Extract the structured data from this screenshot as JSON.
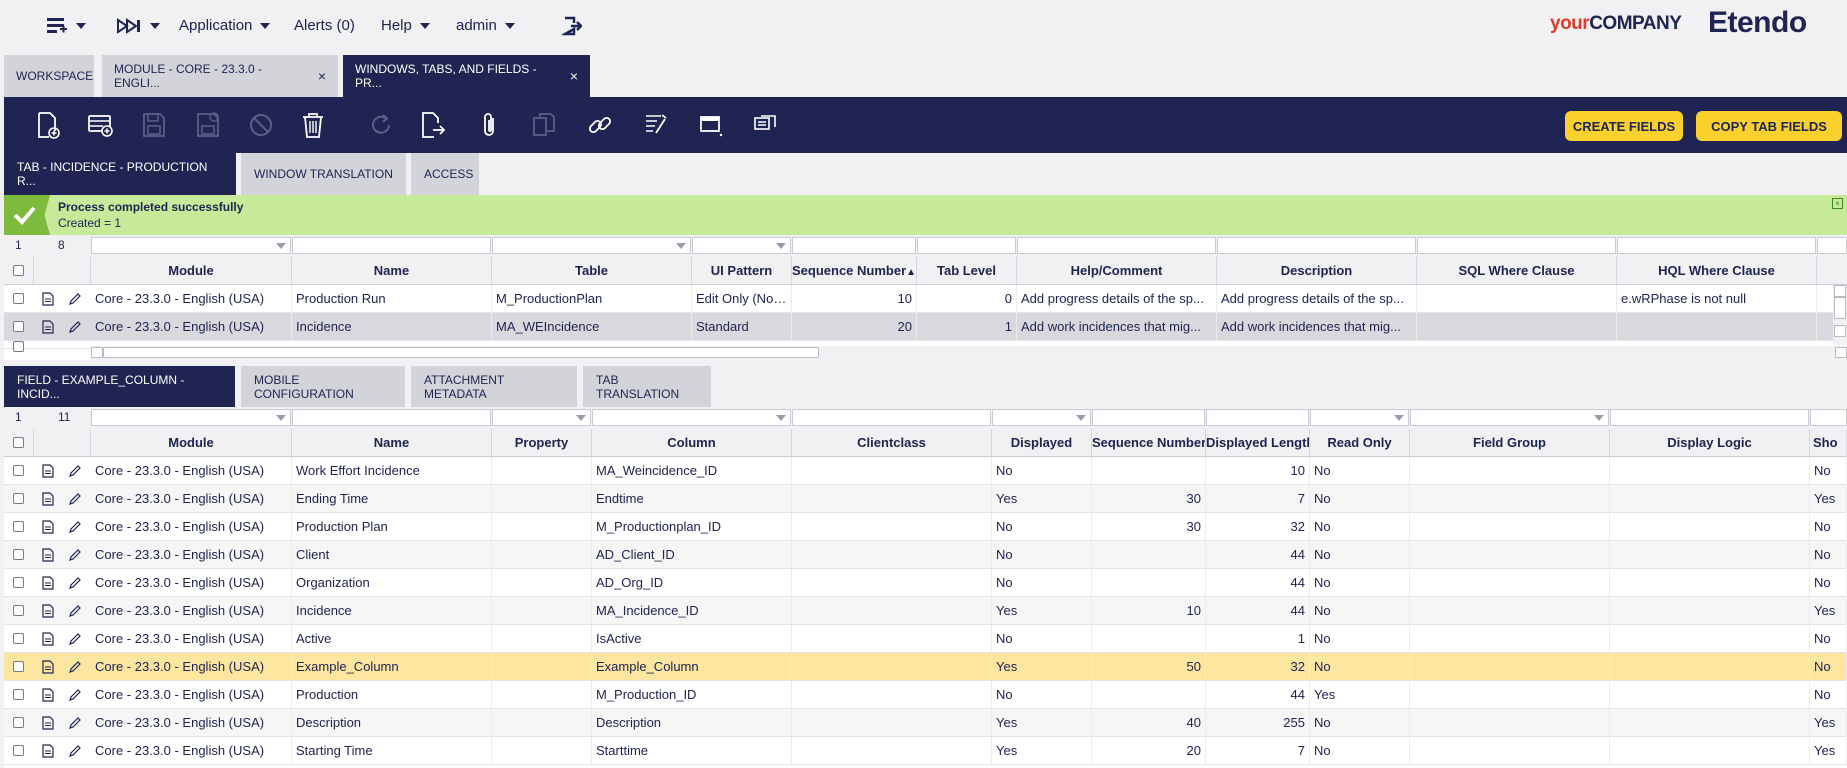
{
  "topbar": {
    "application": "Application",
    "alerts": "Alerts (0)",
    "help": "Help",
    "user": "admin",
    "logo_your": "your",
    "logo_company": "COMPANY",
    "logo_etendo": "Etendo"
  },
  "main_tabs": [
    {
      "label": "WORKSPACE",
      "closable": false
    },
    {
      "label": "MODULE - CORE - 23.3.0 - ENGLI...",
      "closable": true
    },
    {
      "label": "WINDOWS, TABS, AND FIELDS - PR...",
      "closable": true,
      "active": true
    }
  ],
  "toolbar": {
    "icons": [
      "new-document-icon",
      "new-row-icon",
      "save-icon",
      "save-close-icon",
      "undo-icon",
      "delete-icon",
      "refresh-icon",
      "export-icon",
      "attachment-icon",
      "clone-icon",
      "link-icon",
      "audit-trail-icon",
      "form-grid-toggle-icon",
      "notes-icon"
    ],
    "create_fields": "CREATE FIELDS",
    "copy_tab_fields": "COPY TAB FIELDS"
  },
  "tab_level": {
    "tabs": [
      {
        "label": "TAB - INCIDENCE - PRODUCTION R...",
        "active": true
      },
      {
        "label": "WINDOW TRANSLATION"
      },
      {
        "label": "ACCESS"
      }
    ]
  },
  "message": {
    "title": "Process completed successfully",
    "detail": "Created = 1"
  },
  "upper_grid": {
    "selected_count": "1",
    "total_count": "8",
    "columns": [
      "Module",
      "Name",
      "Table",
      "UI Pattern",
      "Sequence Number",
      "Tab Level",
      "Help/Comment",
      "Description",
      "SQL Where Clause",
      "HQL Where Clause"
    ],
    "sort_indicator": "▲",
    "rows": [
      [
        "Core - 23.3.0 - English (USA)",
        "Production Run",
        "M_ProductionPlan",
        "Edit Only (No I...",
        "10",
        "0",
        "Add progress details of the sp...",
        "Add progress details of the sp...",
        "",
        "e.wRPhase is not null"
      ],
      [
        "Core - 23.3.0 - English (USA)",
        "Incidence",
        "MA_WEIncidence",
        "Standard",
        "20",
        "1",
        "Add work incidences that mig...",
        "Add work incidences that mig...",
        "",
        ""
      ]
    ]
  },
  "field_level": {
    "tabs": [
      {
        "label": "FIELD - EXAMPLE_COLUMN - INCID...",
        "active": true
      },
      {
        "label": "MOBILE CONFIGURATION"
      },
      {
        "label": "ATTACHMENT METADATA"
      },
      {
        "label": "TAB TRANSLATION"
      }
    ]
  },
  "lower_grid": {
    "selected_count": "1",
    "total_count": "11",
    "columns": [
      "Module",
      "Name",
      "Property",
      "Column",
      "Clientclass",
      "Displayed",
      "Sequence Number",
      "Displayed Length",
      "Read Only",
      "Field Group",
      "Display Logic",
      "Sho"
    ],
    "rows": [
      [
        "Core - 23.3.0 - English (USA)",
        "Work Effort Incidence",
        "",
        "MA_Weincidence_ID",
        "",
        "No",
        "",
        "10",
        "No",
        "",
        "",
        "No"
      ],
      [
        "Core - 23.3.0 - English (USA)",
        "Ending Time",
        "",
        "Endtime",
        "",
        "Yes",
        "30",
        "7",
        "No",
        "",
        "",
        "Yes"
      ],
      [
        "Core - 23.3.0 - English (USA)",
        "Production Plan",
        "",
        "M_Productionplan_ID",
        "",
        "No",
        "30",
        "32",
        "No",
        "",
        "",
        "No"
      ],
      [
        "Core - 23.3.0 - English (USA)",
        "Client",
        "",
        "AD_Client_ID",
        "",
        "No",
        "",
        "44",
        "No",
        "",
        "",
        "No"
      ],
      [
        "Core - 23.3.0 - English (USA)",
        "Organization",
        "",
        "AD_Org_ID",
        "",
        "No",
        "",
        "44",
        "No",
        "",
        "",
        "No"
      ],
      [
        "Core - 23.3.0 - English (USA)",
        "Incidence",
        "",
        "MA_Incidence_ID",
        "",
        "Yes",
        "10",
        "44",
        "No",
        "",
        "",
        "Yes"
      ],
      [
        "Core - 23.3.0 - English (USA)",
        "Active",
        "",
        "IsActive",
        "",
        "No",
        "",
        "1",
        "No",
        "",
        "",
        "No"
      ],
      [
        "Core - 23.3.0 - English (USA)",
        "Example_Column",
        "",
        "Example_Column",
        "",
        "Yes",
        "50",
        "32",
        "No",
        "",
        "",
        "No"
      ],
      [
        "Core - 23.3.0 - English (USA)",
        "Production",
        "",
        "M_Production_ID",
        "",
        "No",
        "",
        "44",
        "Yes",
        "",
        "",
        "No"
      ],
      [
        "Core - 23.3.0 - English (USA)",
        "Description",
        "",
        "Description",
        "",
        "Yes",
        "40",
        "255",
        "No",
        "",
        "",
        "Yes"
      ],
      [
        "Core - 23.3.0 - English (USA)",
        "Starting Time",
        "",
        "Starttime",
        "",
        "Yes",
        "20",
        "7",
        "No",
        "",
        "",
        "Yes"
      ]
    ],
    "highlight_row": 7
  },
  "colors": {
    "navy": "#202452",
    "accent_yellow": "#fad02c",
    "success_green": "#c6ea9a",
    "highlight_row": "#fde6a0"
  }
}
